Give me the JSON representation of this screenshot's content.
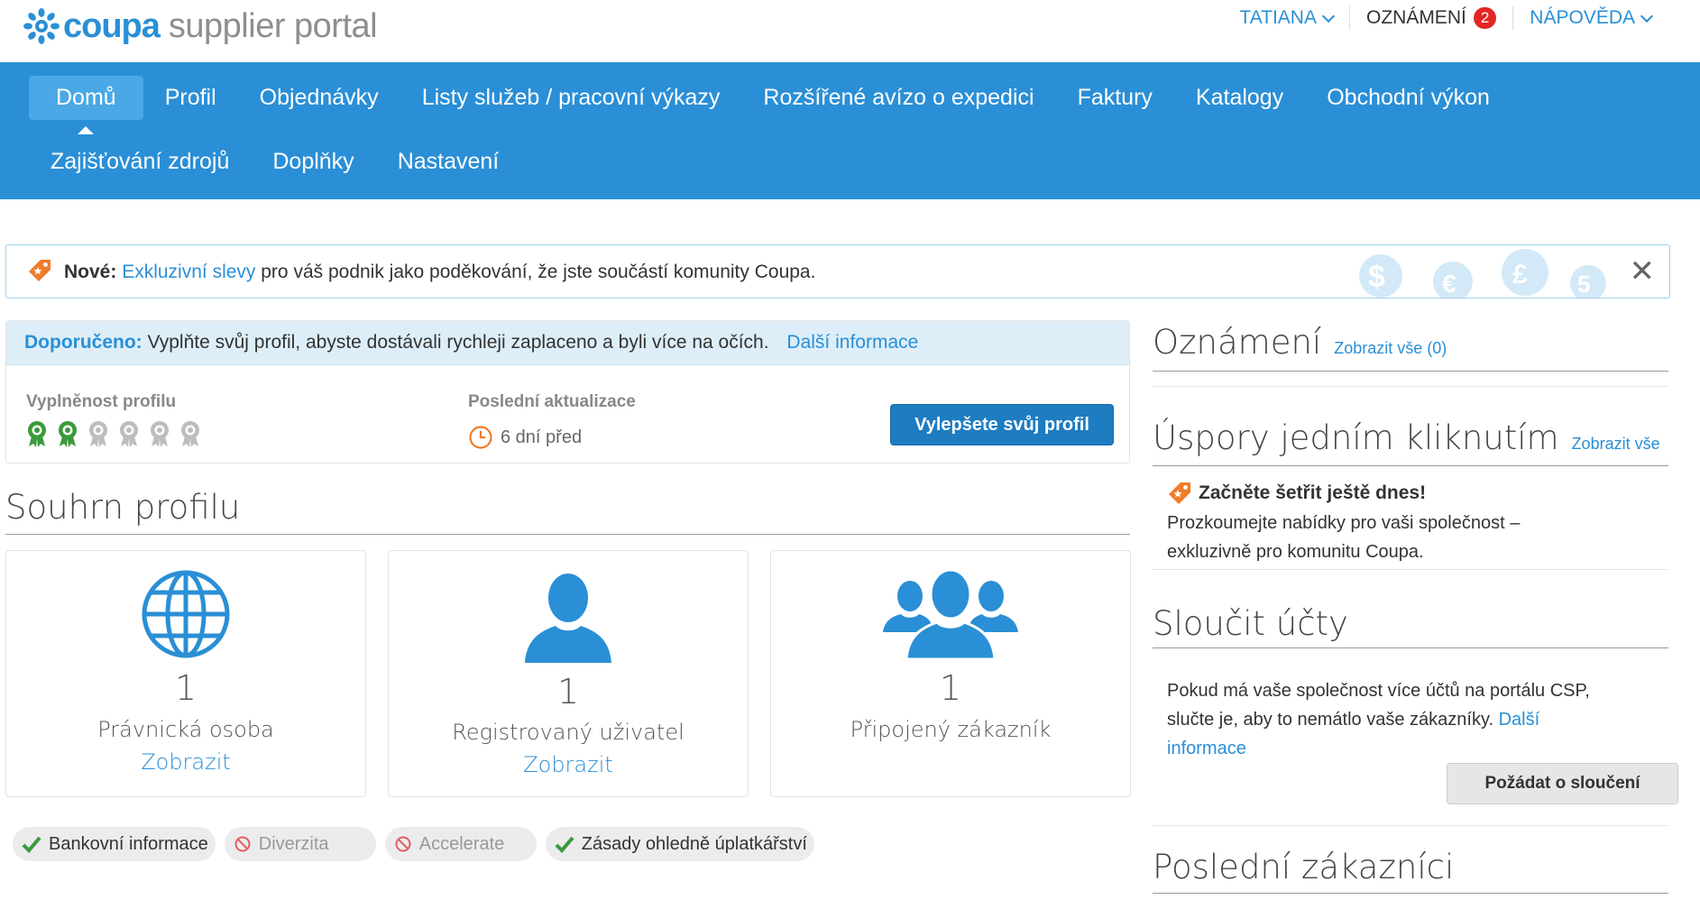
{
  "header": {
    "logo_brand": "coupa",
    "logo_suffix": "supplier portal",
    "user_label": "TATIANA",
    "notifications_label": "OZNÁMENÍ",
    "notifications_count": "2",
    "help_label": "NÁPOVĚDA"
  },
  "nav": {
    "row1": [
      "Domů",
      "Profil",
      "Objednávky",
      "Listy služeb / pracovní výkazy",
      "Rozšířené avízo o expedici",
      "Faktury",
      "Katalogy",
      "Obchodní výkon"
    ],
    "row2": [
      "Zajišťování zdrojů",
      "Doplňky",
      "Nastavení"
    ],
    "active": "Domů"
  },
  "promo": {
    "prefix": "Nové:",
    "link": "Exkluzivní slevy",
    "text": " pro váš podnik jako poděkování, že jste součástí komunity Coupa.",
    "close_glyph": "✕"
  },
  "recommended": {
    "prefix": "Doporučeno:",
    "text": " Vyplňte svůj profil, abyste dostávali rychleji zaplaceno a byli více na očích.",
    "link": "Další informace",
    "completeness_label": "Vyplněnost profilu",
    "completeness_filled": 2,
    "completeness_total": 6,
    "last_update_label": "Poslední aktualizace",
    "last_update_value": "6 dní před",
    "improve_button": "Vylepšete svůj profil"
  },
  "summary": {
    "title": "Souhrn profilu",
    "cards": [
      {
        "count": "1",
        "label": "Právnická osoba",
        "link": "Zobrazit",
        "icon": "globe-icon"
      },
      {
        "count": "1",
        "label": "Registrovaný uživatel",
        "link": "Zobrazit",
        "icon": "user-icon"
      },
      {
        "count": "1",
        "label": "Připojený zákazník",
        "link": "",
        "icon": "group-icon"
      }
    ],
    "pills": [
      {
        "label": "Bankovní informace",
        "status": "ok"
      },
      {
        "label": "Diverzita",
        "status": "no"
      },
      {
        "label": "Accelerate",
        "status": "no"
      },
      {
        "label": "Zásady ohledně úplatkářství",
        "status": "ok"
      }
    ]
  },
  "right": {
    "announcements_title": "Oznámení",
    "announcements_link": "Zobrazit vše (0)",
    "savings_title": "Úspory jedním kliknutím",
    "savings_link": "Zobrazit vše",
    "savings_headline": "Začněte šetřit ještě dnes!",
    "savings_line1": "Prozkoumejte nabídky pro vaši společnost –",
    "savings_line2": "exkluzivně pro komunitu Coupa.",
    "merge_title": "Sloučit účty",
    "merge_line1": "Pokud má vaše společnost více účtů na portálu CSP,",
    "merge_line2": "slučte je, aby to nemátlo vaše zákazníky.",
    "merge_link1": "Další",
    "merge_link2": "informace",
    "merge_button": "Požádat o sloučení",
    "recent_title": "Poslední zákazníci"
  },
  "colors": {
    "brand_blue": "#2a8fd6",
    "nav_active": "#4aa8e6",
    "primary_button": "#1e7cc1",
    "orange_tag": "#f07c2a",
    "badge_red": "#e32727",
    "medal_green": "#3a9a3a"
  }
}
